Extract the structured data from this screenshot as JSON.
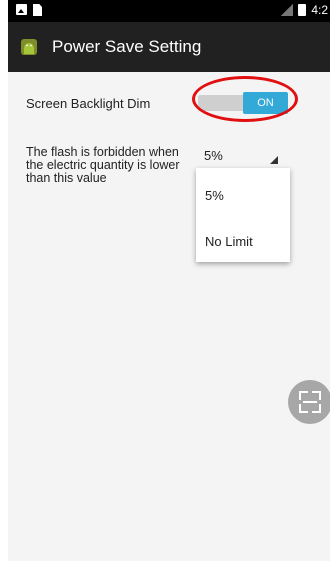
{
  "statusbar": {
    "time": "4:2",
    "icons_left": [
      "image-icon",
      "sim-card-icon"
    ],
    "icons_right": [
      "no-signal-icon",
      "battery-icon"
    ]
  },
  "appbar": {
    "title": "Power Save Setting",
    "icon": "android-icon"
  },
  "settings": {
    "backlight": {
      "label": "Screen Backlight Dim",
      "state": "ON"
    },
    "flash": {
      "label": "The flash is forbidden when the electric quantity is lower than this value",
      "selected": "5%",
      "options": [
        "5%",
        "No Limit"
      ]
    }
  },
  "fab": {
    "icon": "scan-icon"
  },
  "colors": {
    "toggle_on": "#33a9d8",
    "appbar_bg": "#212121",
    "highlight": "#e01010"
  }
}
